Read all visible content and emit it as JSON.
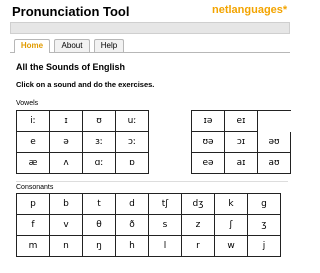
{
  "header": {
    "title": "Pronunciation Tool",
    "brand": "netlanguages",
    "brand_mark": "*"
  },
  "tabs": [
    {
      "label": "Home",
      "active": true
    },
    {
      "label": "About",
      "active": false
    },
    {
      "label": "Help",
      "active": false
    }
  ],
  "main": {
    "heading": "All the Sounds of English",
    "instruction": "Click on a sound and do the exercises.",
    "vowels_label": "Vowels",
    "consonants_label": "Consonants"
  },
  "vowels_left": [
    "iː",
    "ɪ",
    "ʊ",
    "uː",
    "e",
    "ə",
    "ɜː",
    "ɔː",
    "æ",
    "ʌ",
    "ɑː",
    "ɒ"
  ],
  "vowels_right": [
    "ɪə",
    "eɪ",
    "",
    "ʊə",
    "ɔɪ",
    "əʊ",
    "eə",
    "aɪ",
    "aʊ"
  ],
  "consonants": [
    "p",
    "b",
    "t",
    "d",
    "tʃ",
    "dʒ",
    "k",
    "g",
    "f",
    "v",
    "θ",
    "ð",
    "s",
    "z",
    "ʃ",
    "ʒ",
    "m",
    "n",
    "ŋ",
    "h",
    "l",
    "r",
    "w",
    "j"
  ],
  "colors": {
    "brand": "#f3a400",
    "active_tab": "#e19b00"
  }
}
